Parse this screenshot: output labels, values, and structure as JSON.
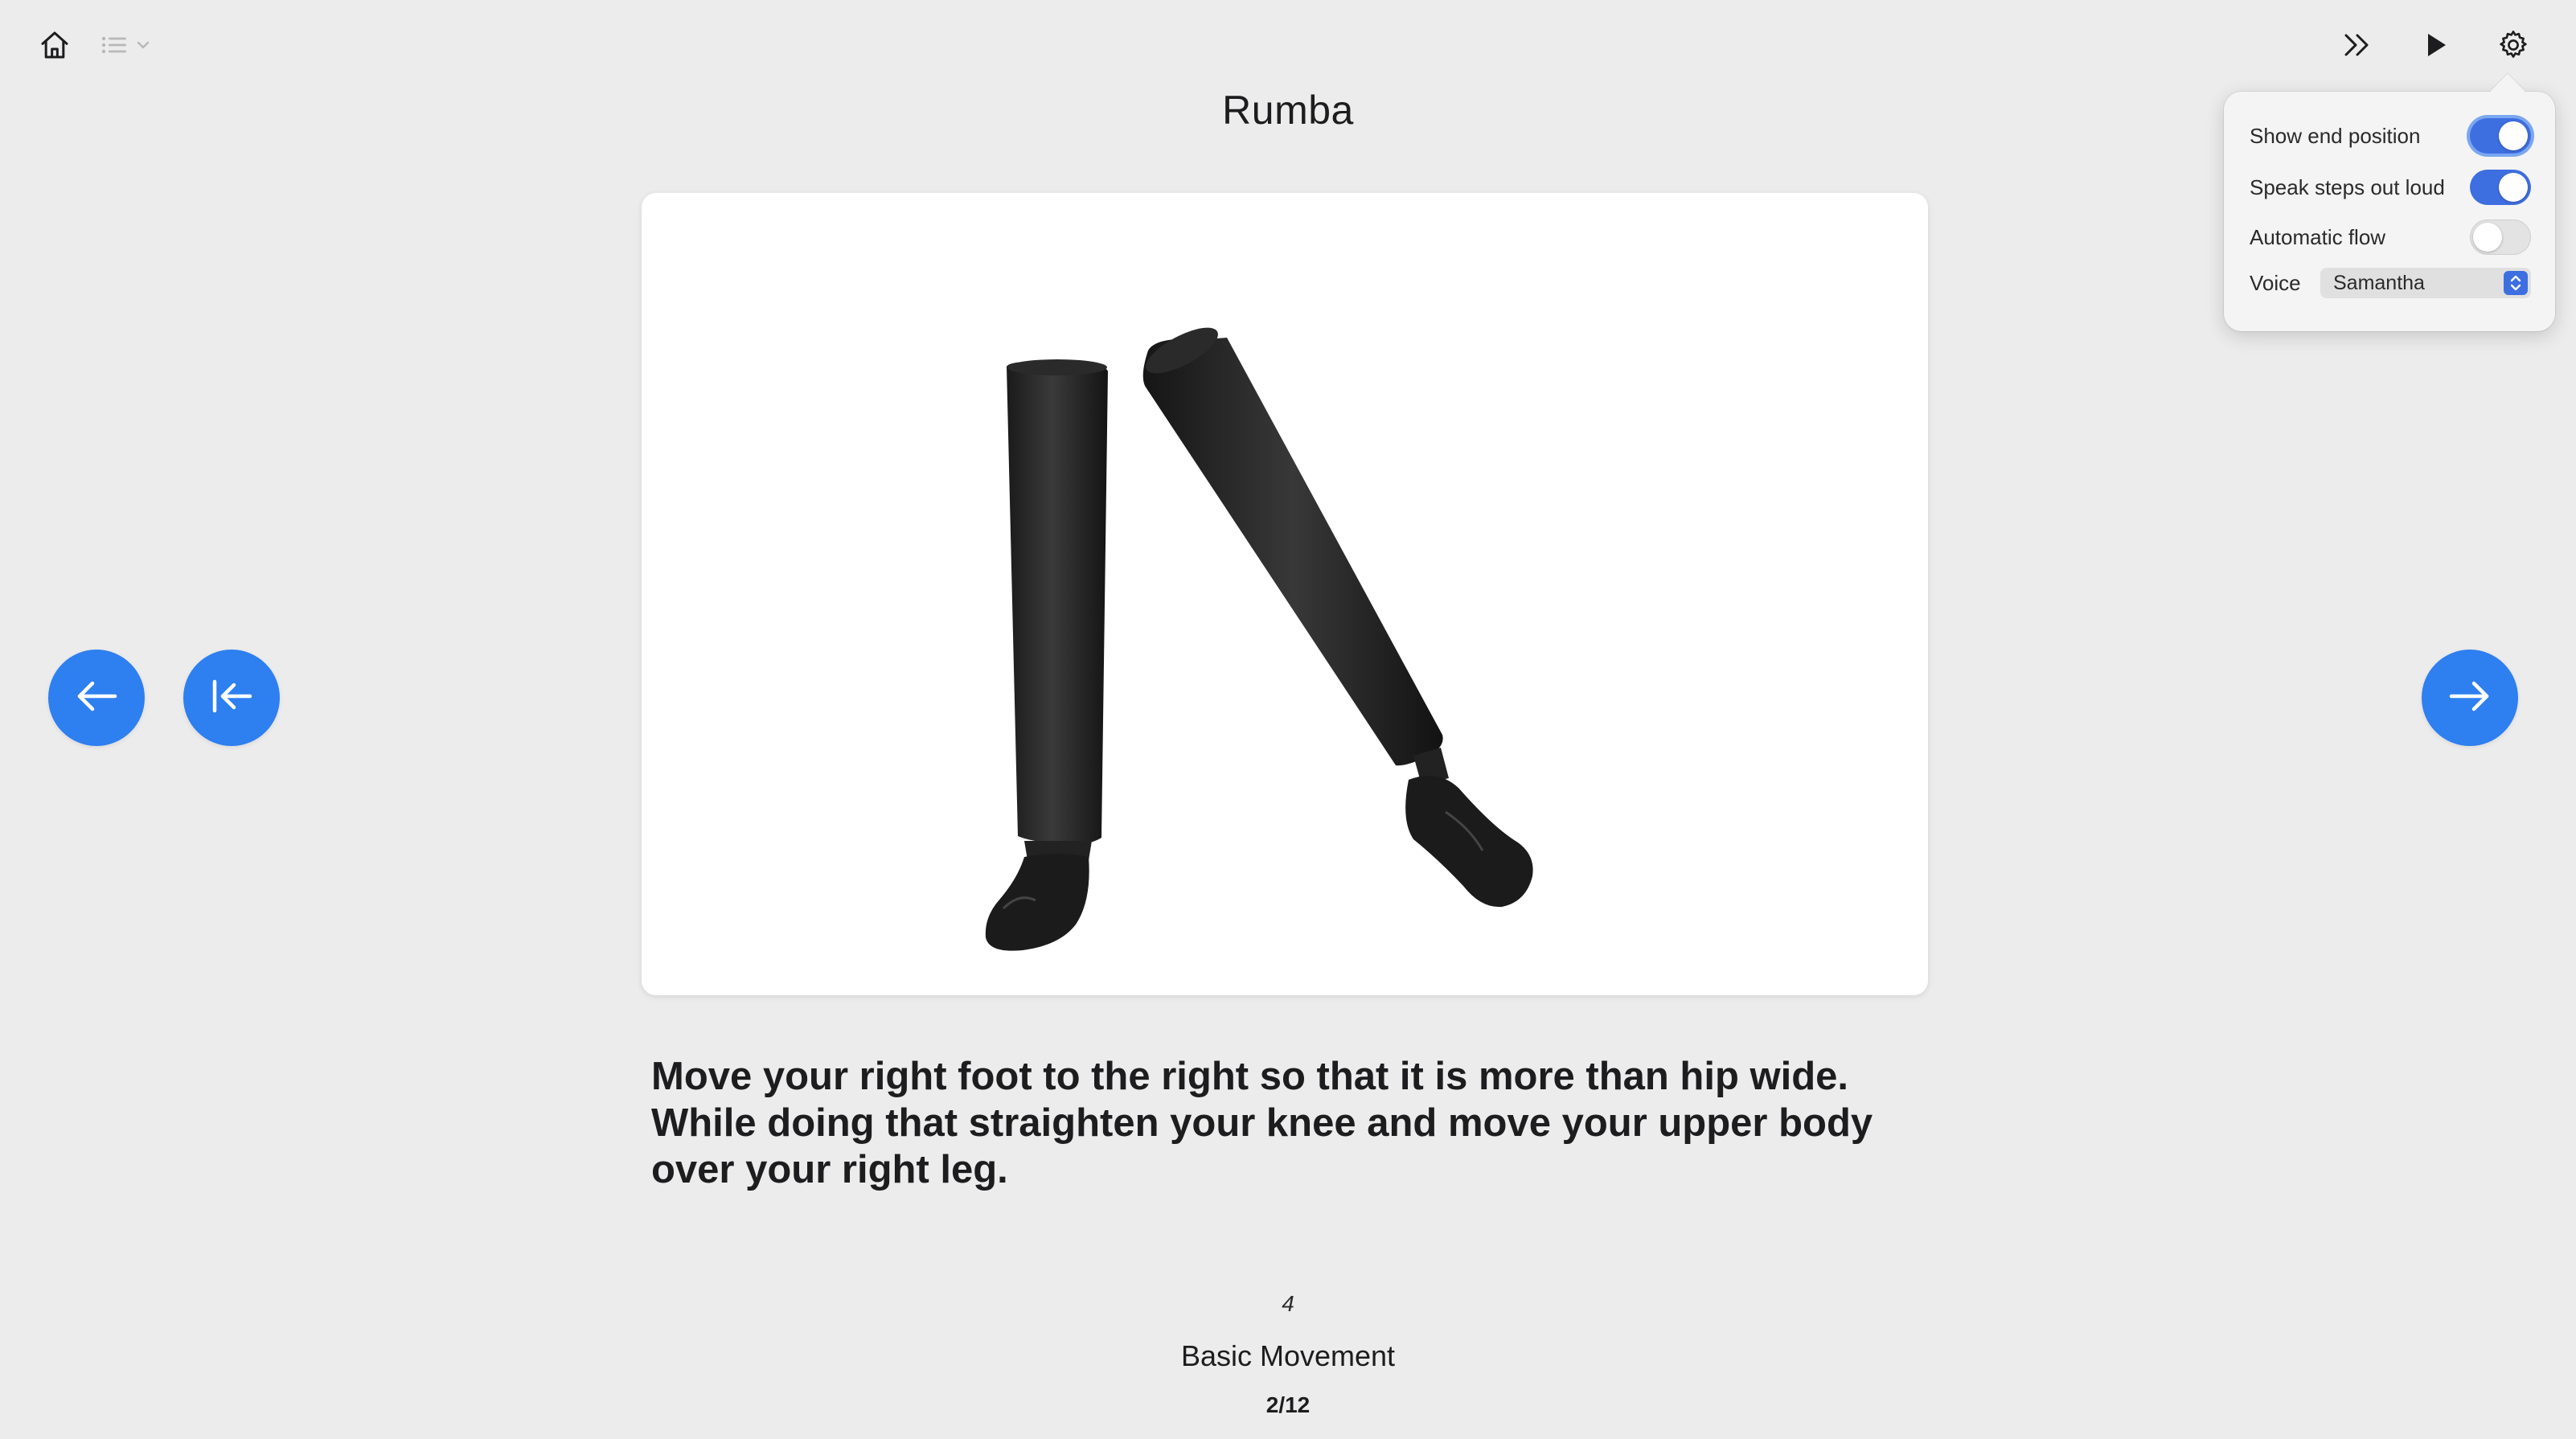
{
  "header": {
    "title": "Rumba",
    "icons": {
      "home": "home-icon",
      "list": "list-icon",
      "dropdown": "chevron-down-icon",
      "skip": "fast-forward-icon",
      "play": "play-icon",
      "settings": "gear-icon"
    }
  },
  "navigation": {
    "previous_icon": "arrow-left-icon",
    "restart_icon": "arrow-to-start-icon",
    "next_icon": "arrow-right-icon",
    "accent_color": "#2e7ff0"
  },
  "step": {
    "instruction": "Move your right foot to the right so that it is more than hip wide. While doing that straighten your knee and move your upper body over your right leg.",
    "count": "4",
    "figure_name": "Basic Movement",
    "progress": "2/12"
  },
  "settings": {
    "options": [
      {
        "label": "Show end position",
        "enabled": true
      },
      {
        "label": "Speak steps out loud",
        "enabled": true
      },
      {
        "label": "Automatic flow",
        "enabled": false
      }
    ],
    "voice": {
      "label": "Voice",
      "value": "Samantha"
    },
    "toggle_on_color": "#3e6fe0"
  }
}
